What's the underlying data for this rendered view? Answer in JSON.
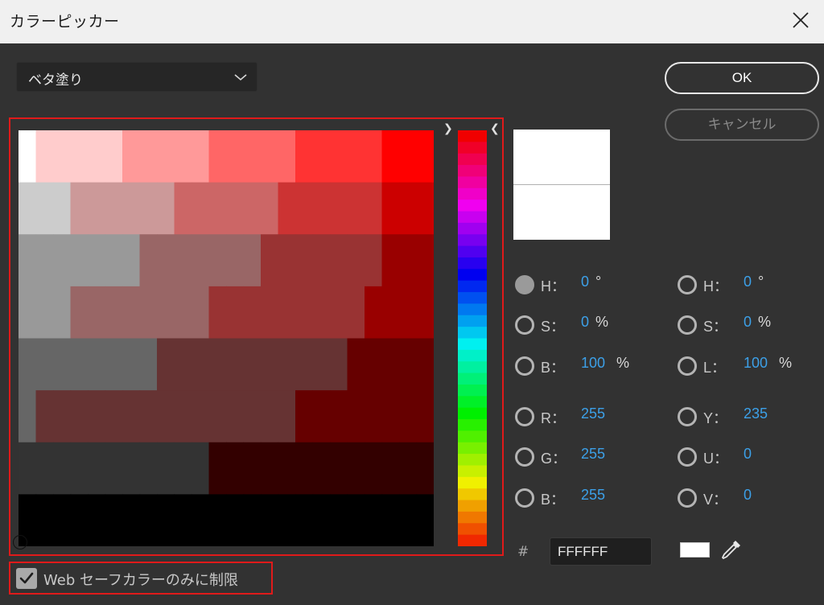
{
  "window": {
    "title": "カラーピッカー",
    "close_icon": "close-icon"
  },
  "fill": {
    "selected": "ベタ塗り"
  },
  "buttons": {
    "ok": "OK",
    "cancel": "キャンセル"
  },
  "hsb": {
    "h": {
      "label": "H：",
      "value": "0",
      "unit": "°"
    },
    "s": {
      "label": "S：",
      "value": "0",
      "unit": "%"
    },
    "b": {
      "label": "B：",
      "value": "100",
      "unit": "%"
    }
  },
  "hsl": {
    "h": {
      "label": "H：",
      "value": "0",
      "unit": "°"
    },
    "s": {
      "label": "S：",
      "value": "0",
      "unit": "%"
    },
    "l": {
      "label": "L：",
      "value": "100",
      "unit": "%"
    }
  },
  "rgb": {
    "r": {
      "label": "R：",
      "value": "255"
    },
    "g": {
      "label": "G：",
      "value": "255"
    },
    "b": {
      "label": "B：",
      "value": "255"
    }
  },
  "yuv": {
    "y": {
      "label": "Y：",
      "value": "235"
    },
    "u": {
      "label": "U：",
      "value": "0"
    },
    "v": {
      "label": "V：",
      "value": "0"
    }
  },
  "hex": {
    "prefix": "#",
    "value": "FFFFFF"
  },
  "web_safe": {
    "label": "Web セーフカラーのみに制限",
    "checked": true
  },
  "colors": {
    "current": "#FFFFFF",
    "highlight": "#E01A1A",
    "value_text": "#3CA0E8"
  }
}
